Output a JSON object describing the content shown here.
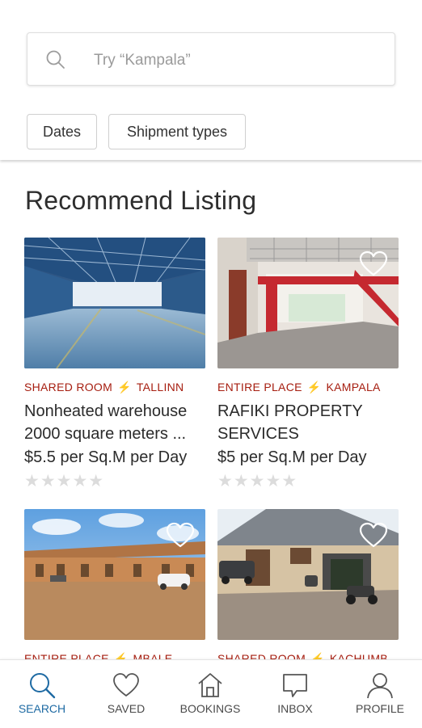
{
  "search": {
    "placeholder": "Try “Kampala”"
  },
  "filters": {
    "dates": "Dates",
    "shipment_types": "Shipment types"
  },
  "section_title": "Recommend Listing",
  "listings": [
    {
      "type": "SHARED ROOM",
      "city": "TALLINN",
      "title": "Nonheated warehouse 2000 square meters ...",
      "price": "$5.5 per Sq.M per Day",
      "rating": 0
    },
    {
      "type": "ENTIRE PLACE",
      "city": "KAMPALA",
      "title": "RAFIKI PROPERTY SERVICES",
      "price": "$5 per Sq.M per Day",
      "rating": 0
    },
    {
      "type": "ENTIRE PLACE",
      "city": "MBALE"
    },
    {
      "type": "SHARED ROOM",
      "city": "KACHUMB"
    }
  ],
  "stars": "★★★★★",
  "bolt": "⚡",
  "tabs": [
    {
      "label": "SEARCH",
      "icon": "search-icon",
      "active": true
    },
    {
      "label": "SAVED",
      "icon": "heart-icon"
    },
    {
      "label": "BOOKINGS",
      "icon": "house-icon"
    },
    {
      "label": "INBOX",
      "icon": "chat-bubble-icon"
    },
    {
      "label": "PROFILE",
      "icon": "person-icon"
    }
  ],
  "colors": {
    "accent": "#1e6aa3",
    "listing_meta": "#a61d0f",
    "bolt": "#f0b400",
    "stars_empty": "#dcdcdc"
  }
}
